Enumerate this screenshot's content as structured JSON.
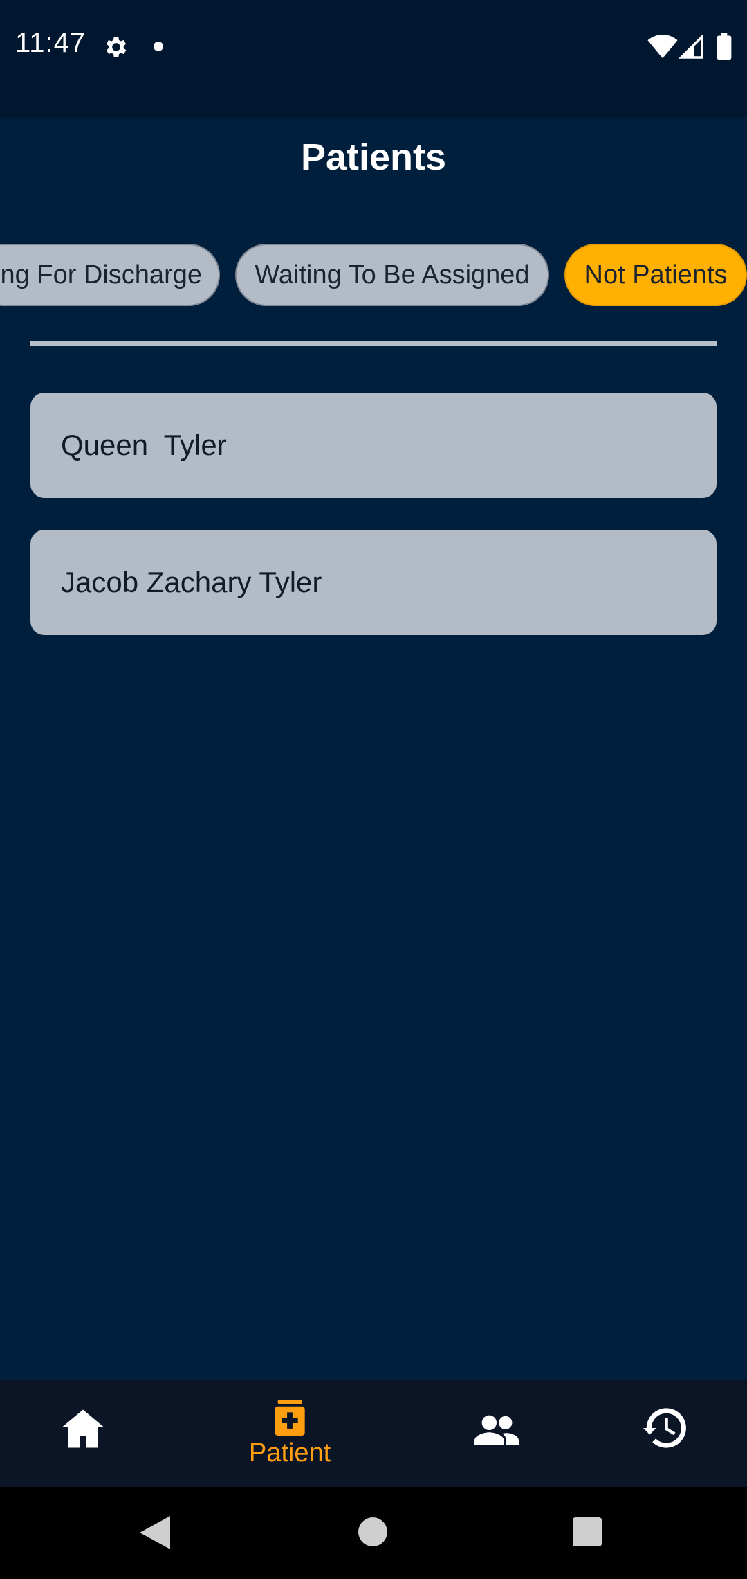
{
  "status_bar": {
    "time": "11:47",
    "icons": [
      "gear-icon",
      "notification-dot-icon",
      "wifi-icon",
      "signal-icon",
      "battery-icon"
    ]
  },
  "header": {
    "title": "Patients"
  },
  "filters": {
    "chips": [
      {
        "label": "ng For Discharge",
        "active": false
      },
      {
        "label": "Waiting To Be Assigned",
        "active": false
      },
      {
        "label": "Not Patients",
        "active": true
      }
    ]
  },
  "patients": [
    {
      "name": "Queen  Tyler"
    },
    {
      "name": "Jacob Zachary Tyler"
    }
  ],
  "bottom_nav": {
    "items": [
      {
        "icon": "home-icon",
        "label": ""
      },
      {
        "icon": "patient-icon",
        "label": "Patient",
        "active": true
      },
      {
        "icon": "people-icon",
        "label": ""
      },
      {
        "icon": "history-icon",
        "label": ""
      }
    ]
  },
  "colors": {
    "background": "#001f3d",
    "status_bar": "#00172f",
    "chip": "#b3bbc6",
    "chip_active": "#ffb000",
    "nav_active": "#ff9f0f"
  }
}
